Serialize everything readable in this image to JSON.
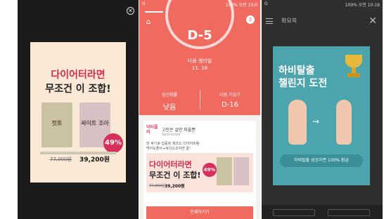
{
  "panel1": {
    "close_icon": "close-circle-icon",
    "ad": {
      "headline1": "다이어터라면",
      "headline2": "무조건 이 조합!",
      "product_a": "컷토",
      "product_b": "싸이트 조아",
      "discount_badge": "49%",
      "old_price": "77,000원",
      "new_price": "39,200원"
    }
  },
  "panel2": {
    "status": {
      "left": "G",
      "right": "100% 오전 10:0"
    },
    "nav": {
      "home_icon": "home-icon",
      "notification_count": "2"
    },
    "dday": "D-5",
    "next_period_label": "다음 생리일",
    "next_period_date": "11. 18",
    "stats": {
      "left_label": "임신확률",
      "left_value": "낮음",
      "right_label": "다음 가임기",
      "right_value": "D-16"
    },
    "sponsor": {
      "brand": "닥터플러",
      "title": "고민은 살만 피울뿐",
      "sponsored": "Sponsored",
      "desc1": "딴 후기로 입증된 제조드 다이어트템",
      "desc2": "먹어도좋아+싸이드조아면 끝!"
    },
    "ad": {
      "headline1": "다이어터라면",
      "headline2": "무조건 이 조합!",
      "discount_badge": "49%",
      "old_price": "77,000원",
      "new_price": "39,200원"
    },
    "cta_label": "전체하기기"
  },
  "panel3": {
    "status": {
      "left": "G",
      "right": "100% 오전 10:19"
    },
    "header_title": "화요북",
    "menu_icon": "hamburger-icon",
    "close_icon": "close-icon",
    "popup": {
      "title1": "하비탈출",
      "title2": "챌린지 도전",
      "pill_text": "하비탈출 성공하면 100% 환급"
    }
  }
}
